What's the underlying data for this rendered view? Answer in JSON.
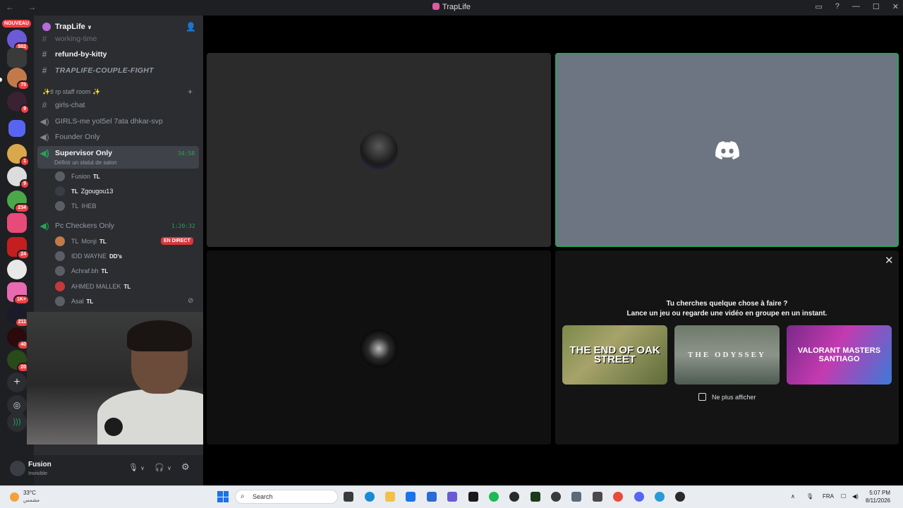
{
  "window": {
    "title": "TrapLife",
    "nav": "← →"
  },
  "rail": {
    "new_badge": "NOUVEAU",
    "badges": [
      "502",
      "75",
      "9",
      "1",
      "9",
      "234",
      "24",
      "1K+",
      "211",
      "40",
      "20"
    ]
  },
  "server": {
    "name": "TrapLife",
    "chevron": "∨"
  },
  "channels": {
    "working_time": "working-time",
    "refund": "refund-by-kitty",
    "couple_fight": "TRAPLIFE-COUPLE-FIGHT",
    "category": "✨tl rp staff room ✨",
    "girls_chat": "girls-chat",
    "girls_voice": "GIRLS-me yot5el 7ata dhkar-svp",
    "founder": "Founder Only",
    "supervisor": "Supervisor Only",
    "supervisor_timer": "34:58",
    "supervisor_status": "Définir un statut de salon",
    "pc_checkers": "Pc Checkers Only",
    "pc_timer": "1:20:32",
    "live_badge": "EN DIRECT"
  },
  "voice_users": {
    "u1": {
      "name": "Fusion",
      "tag": "TL"
    },
    "u2": {
      "prefix": "TL",
      "name": "Zgougou13"
    },
    "u3": {
      "prefix": "TL",
      "name": "IHEB"
    },
    "u4": {
      "prefix": "TL",
      "name": "Monji",
      "tag": "TL"
    },
    "u5": {
      "name": "IDD WAYNE",
      "tag": "DD's"
    },
    "u6": {
      "name": "Achraf.bh",
      "tag": "TL"
    },
    "u7": {
      "name": "AHMED MALLEK",
      "tag": "TL"
    },
    "u8": {
      "name": "Asal",
      "tag": "TL"
    }
  },
  "user_panel": {
    "name": "Fusion",
    "status": "Invisible"
  },
  "activity": {
    "question": "Tu cherches quelque chose à faire ?",
    "subtitle": "Lance un jeu ou regarde une vidéo en groupe en un instant.",
    "cards": [
      "THE END OF OAK STREET",
      "THE ODYSSEY",
      "VALORANT MASTERS SANTIAGO"
    ],
    "dont_show": "Ne plus afficher"
  },
  "taskbar": {
    "temp": "33°C",
    "weather_desc": "مشمس",
    "search": "Search",
    "lang": "FRA",
    "time": "5:07 PM",
    "date": "8/11/2026"
  },
  "colors": {
    "accent_green": "#23a55a",
    "live_red": "#da373c",
    "sidebar": "#2b2d31",
    "rail": "#1e1f22"
  }
}
